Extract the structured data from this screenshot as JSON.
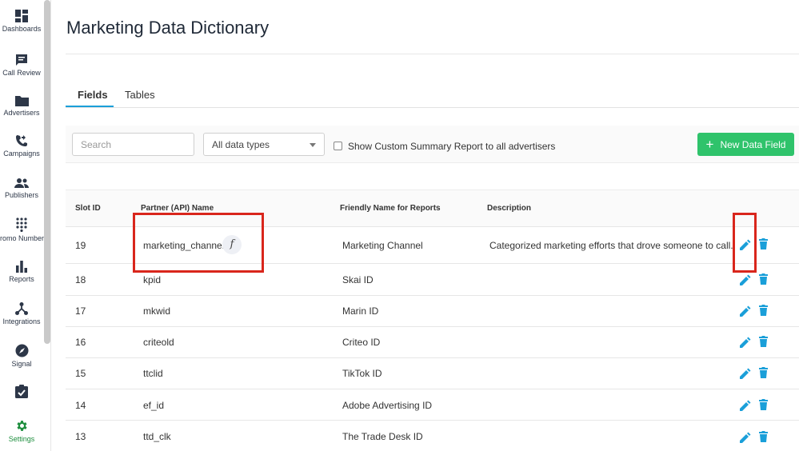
{
  "sidebar": {
    "items": [
      {
        "label": "Dashboards",
        "icon": "dashboard-icon"
      },
      {
        "label": "Call Review",
        "icon": "call-review-icon"
      },
      {
        "label": "Advertisers",
        "icon": "folder-icon"
      },
      {
        "label": "Campaigns",
        "icon": "phone-forward-icon"
      },
      {
        "label": "Publishers",
        "icon": "people-icon"
      },
      {
        "label": "Promo Number",
        "icon": "dialpad-icon"
      },
      {
        "label": "Reports",
        "icon": "bar-chart-icon"
      },
      {
        "label": "Integrations",
        "icon": "network-icon"
      },
      {
        "label": "Signal",
        "icon": "compass-icon"
      },
      {
        "label": "",
        "icon": "clipboard-check-icon"
      },
      {
        "label": "Settings",
        "icon": "gear-icon"
      }
    ]
  },
  "header": {
    "title": "Marketing Data Dictionary"
  },
  "tabs": [
    {
      "label": "Fields",
      "active": true
    },
    {
      "label": "Tables",
      "active": false
    }
  ],
  "toolbar": {
    "search_placeholder": "Search",
    "data_type_select": "All data types",
    "checkbox_label": "Show Custom Summary Report to all advertisers",
    "new_button_label": "New Data Field"
  },
  "table": {
    "columns": [
      "Slot ID",
      "Partner (API) Name",
      "Friendly Name for Reports",
      "Description"
    ],
    "rows": [
      {
        "slot": "19",
        "api_name": "marketing_channel",
        "has_function": true,
        "friendly": "Marketing Channel",
        "description": "Categorized marketing efforts that drove someone to call."
      },
      {
        "slot": "18",
        "api_name": "kpid",
        "has_function": false,
        "friendly": "Skai ID",
        "description": ""
      },
      {
        "slot": "17",
        "api_name": "mkwid",
        "has_function": false,
        "friendly": "Marin ID",
        "description": ""
      },
      {
        "slot": "16",
        "api_name": "criteold",
        "has_function": false,
        "friendly": "Criteo ID",
        "description": ""
      },
      {
        "slot": "15",
        "api_name": "ttclid",
        "has_function": false,
        "friendly": "TikTok ID",
        "description": ""
      },
      {
        "slot": "14",
        "api_name": "ef_id",
        "has_function": false,
        "friendly": "Adobe Advertising ID",
        "description": ""
      },
      {
        "slot": "13",
        "api_name": "ttd_clk",
        "has_function": false,
        "friendly": "The Trade Desk ID",
        "description": ""
      }
    ],
    "function_symbol": "f"
  },
  "colors": {
    "accent_blue": "#1a9fd9",
    "button_green": "#2fc36b",
    "settings_green": "#1e8e3e",
    "highlight_red": "#d9261c",
    "icon_dark": "#2d3748"
  }
}
